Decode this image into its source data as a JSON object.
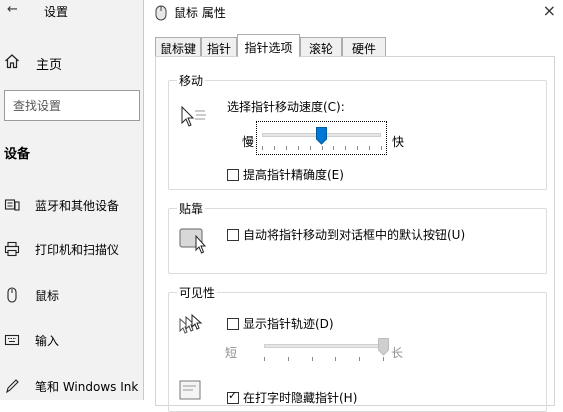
{
  "settings": {
    "back_glyph": "←",
    "title": "设置",
    "home_label": "主页",
    "search_placeholder": "查找设置",
    "section_header": "设备",
    "nav": [
      {
        "label": "蓝牙和其他设备",
        "icon": "bluetooth-devices-icon"
      },
      {
        "label": "打印机和扫描仪",
        "icon": "printer-icon"
      },
      {
        "label": "鼠标",
        "icon": "mouse-icon"
      },
      {
        "label": "输入",
        "icon": "keyboard-icon"
      },
      {
        "label": "笔和 Windows Ink",
        "icon": "pen-icon"
      }
    ]
  },
  "dialog": {
    "title": "鼠标 属性",
    "close_glyph": "×",
    "tabs": [
      {
        "label": "鼠标键",
        "active": false
      },
      {
        "label": "指针",
        "active": false
      },
      {
        "label": "指针选项",
        "active": true
      },
      {
        "label": "滚轮",
        "active": false
      },
      {
        "label": "硬件",
        "active": false
      }
    ],
    "motion": {
      "group_label": "移动",
      "speed_label": "选择指针移动速度(C):",
      "slow_label": "慢",
      "fast_label": "快",
      "speed_level": 0.5,
      "enhance_label": "提高指针精确度(E)",
      "enhance_checked": false
    },
    "snap": {
      "group_label": "贴靠",
      "snap_label": "自动将指针移动到对话框中的默认按钮(U)",
      "snap_checked": false
    },
    "visibility": {
      "group_label": "可见性",
      "trails_label": "显示指针轨迹(D)",
      "trails_checked": false,
      "short_label": "短",
      "long_label": "长",
      "trail_level": 1.0,
      "hide_label": "在打字时隐藏指针(H)",
      "hide_checked": true
    }
  },
  "colors": {
    "accent": "#0078d7",
    "settings_bg": "#f2f2f2"
  }
}
